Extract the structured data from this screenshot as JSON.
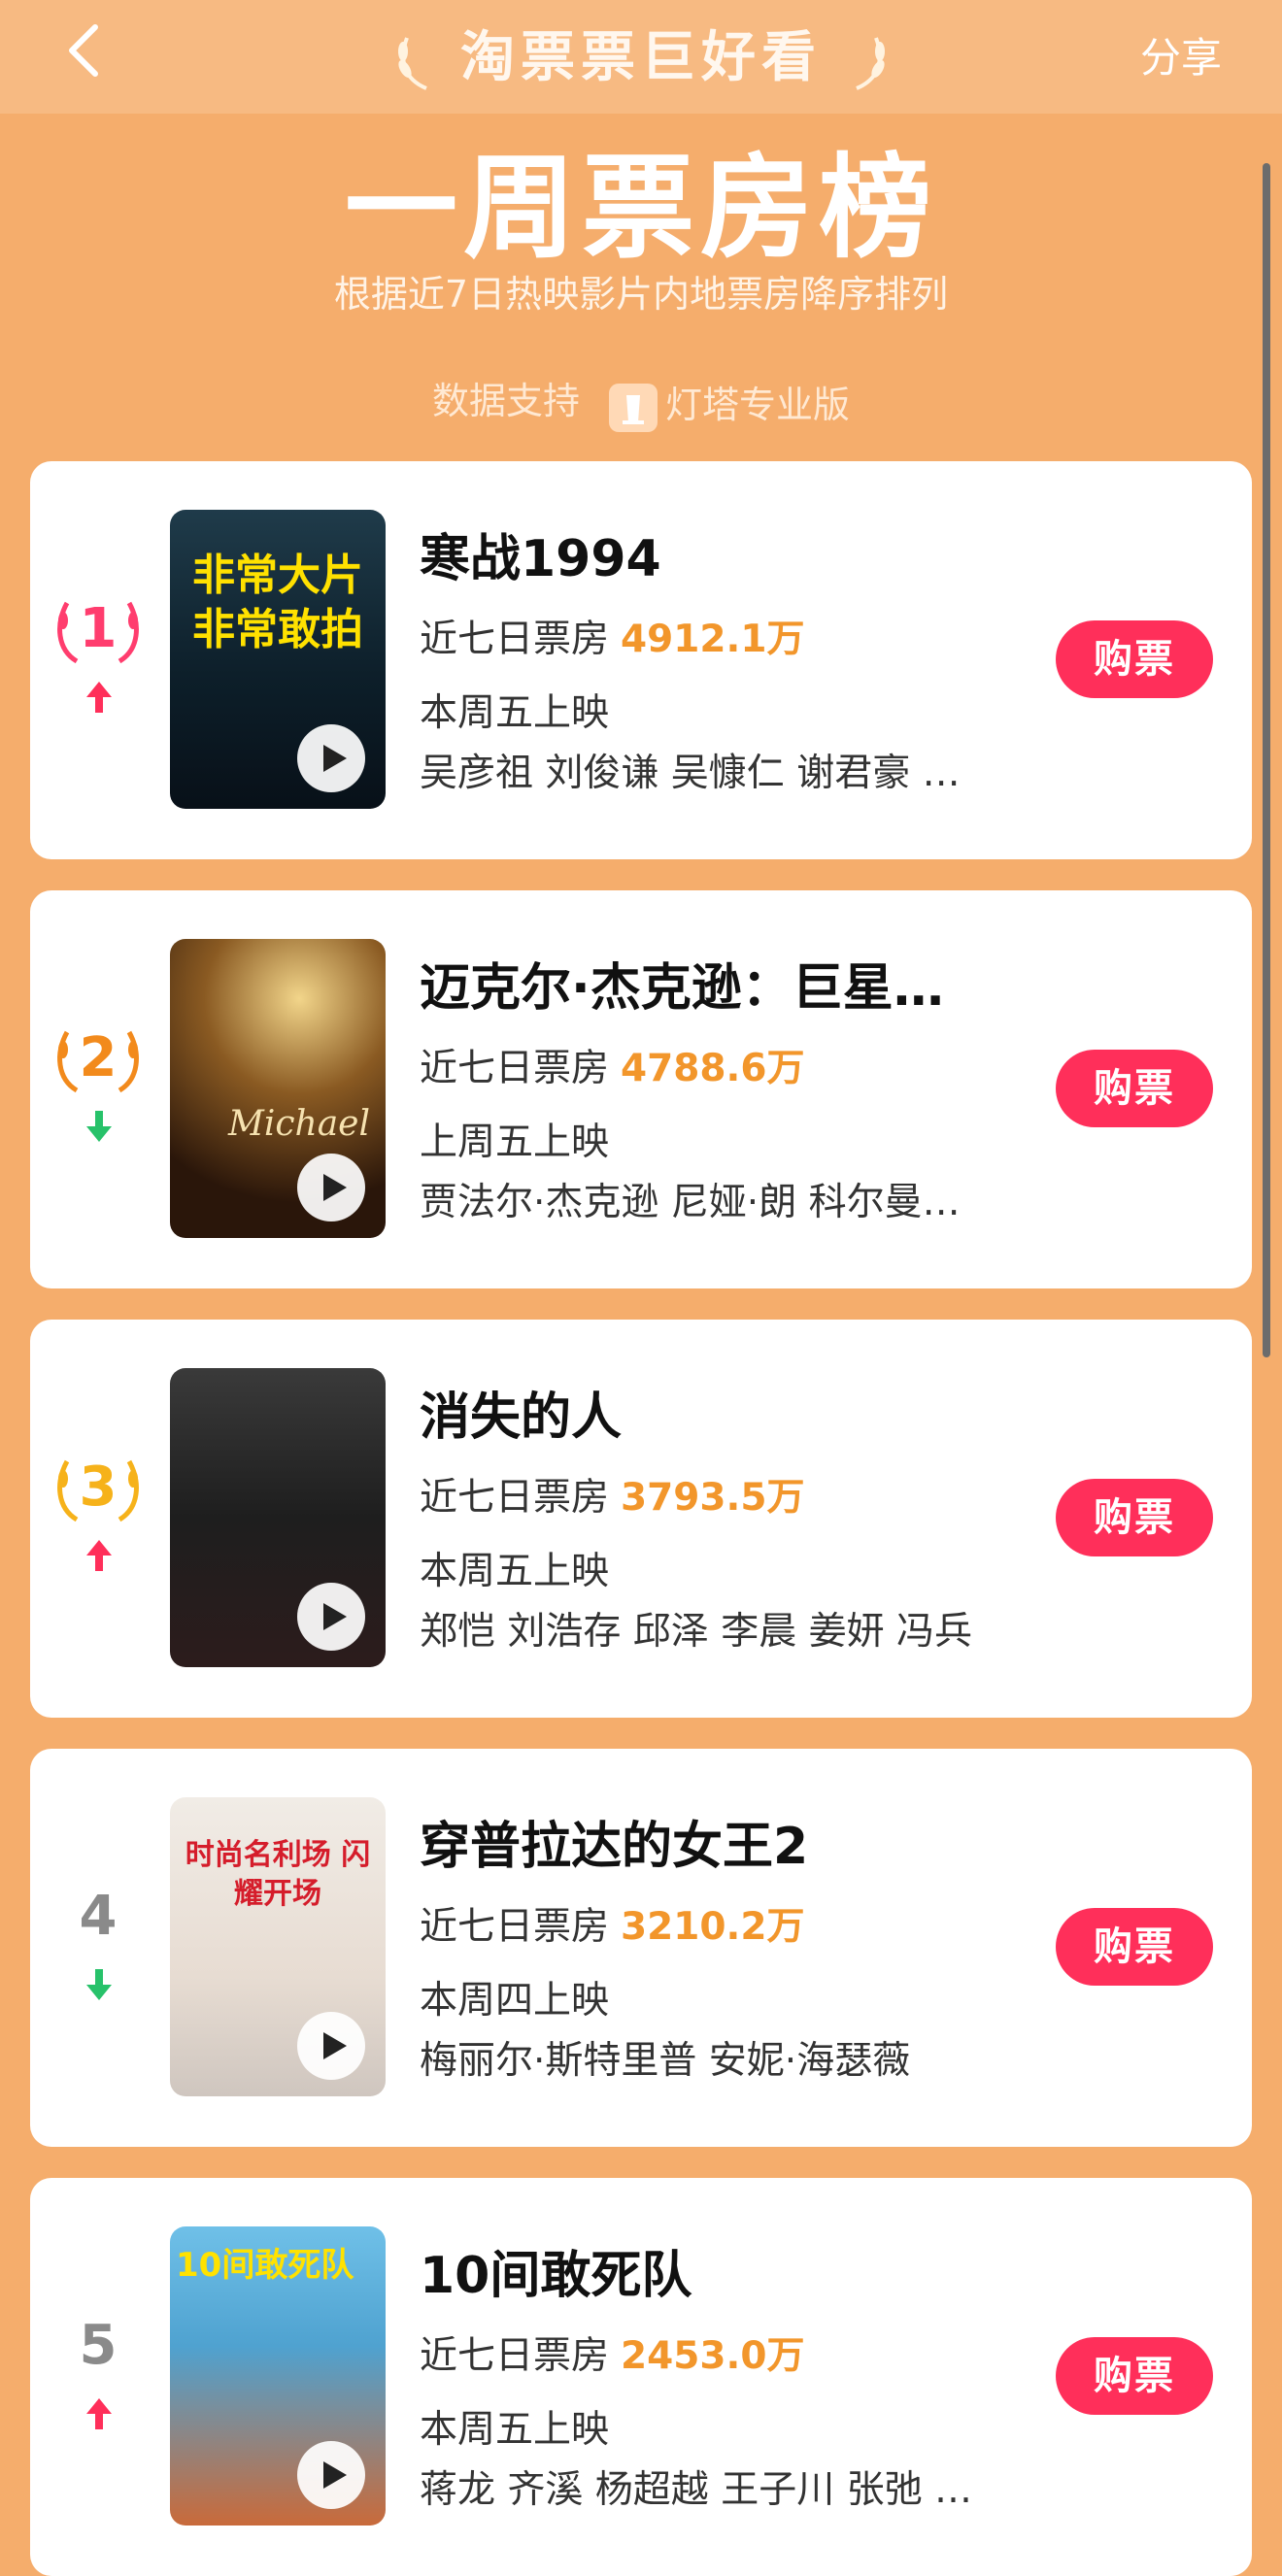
{
  "header": {
    "brand": "淘票票巨好看",
    "share": "分享"
  },
  "page": {
    "title": "一周票房榜",
    "subtitle": "根据近7日热映影片内地票房降序排列",
    "support_prefix": "数据支持",
    "support_name": "灯塔专业版"
  },
  "colors": {
    "accent": "#f2962b",
    "buy": "#ff2f5a",
    "up": "#ff2f5a",
    "down": "#27c26a",
    "rank1": "#ff3d6e",
    "rank2": "#f28a1c",
    "rank3": "#f6b21a",
    "rank_other": "#8a8a8a"
  },
  "common": {
    "box_label": "近七日票房",
    "buy_label": "购票"
  },
  "movies": [
    {
      "rank": "1",
      "trend": "up",
      "title": "寒战1994",
      "box": "4912.1万",
      "release": "本周五上映",
      "cast": "吴彦祖 刘俊谦 吴慷仁 谢君豪 …",
      "poster_text": "非常大片 非常敢拍"
    },
    {
      "rank": "2",
      "trend": "down",
      "title": "迈克尔·杰克逊：巨星…",
      "box": "4788.6万",
      "release": "上周五上映",
      "cast": "贾法尔·杰克逊 尼娅·朗 科尔曼…",
      "poster_text": "Michael"
    },
    {
      "rank": "3",
      "trend": "up",
      "title": "消失的人",
      "box": "3793.5万",
      "release": "本周五上映",
      "cast": "郑恺 刘浩存 邱泽 李晨 姜妍 冯兵",
      "poster_text": ""
    },
    {
      "rank": "4",
      "trend": "down",
      "title": "穿普拉达的女王2",
      "box": "3210.2万",
      "release": "本周四上映",
      "cast": "梅丽尔·斯特里普 安妮·海瑟薇",
      "poster_text": "时尚名利场 闪耀开场"
    },
    {
      "rank": "5",
      "trend": "up",
      "title": "10间敢死队",
      "box": "2453.0万",
      "release": "本周五上映",
      "cast": "蒋龙 齐溪 杨超越 王子川 张弛 …",
      "poster_text": "10间敢死队"
    }
  ]
}
